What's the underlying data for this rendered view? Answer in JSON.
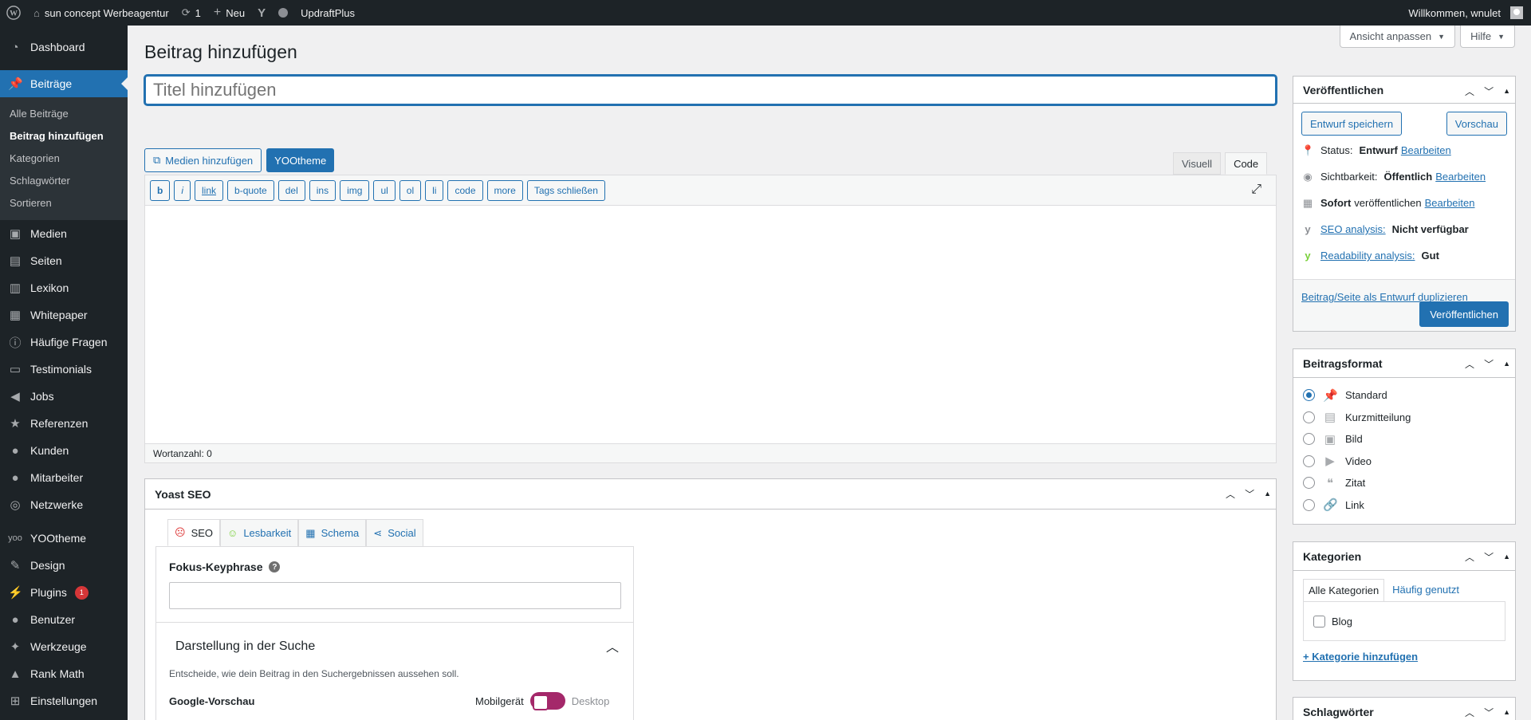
{
  "adminbar": {
    "site_name": "sun concept Werbeagentur",
    "updates_count": "1",
    "new_label": "Neu",
    "plugin_label": "UpdraftPlus",
    "welcome": "Willkommen, wnulet"
  },
  "sidebar": {
    "dashboard": "Dashboard",
    "posts": "Beiträge",
    "sub": [
      "Alle Beiträge",
      "Beitrag hinzufügen",
      "Kategorien",
      "Schlagwörter",
      "Sortieren"
    ],
    "items": [
      "Medien",
      "Seiten",
      "Lexikon",
      "Whitepaper",
      "Häufige Fragen",
      "Testimonials",
      "Jobs",
      "Referenzen",
      "Kunden",
      "Mitarbeiter",
      "Netzwerke",
      "YOOtheme",
      "Design",
      "Plugins",
      "Benutzer",
      "Werkzeuge",
      "Rank Math",
      "Einstellungen"
    ],
    "plugins_badge": "1"
  },
  "screen_options": {
    "customize": "Ansicht anpassen",
    "help": "Hilfe"
  },
  "page": {
    "title": "Beitrag hinzufügen",
    "title_placeholder": "Titel hinzufügen"
  },
  "editor": {
    "add_media": "Medien hinzufügen",
    "yootheme": "YOOtheme",
    "tab_visual": "Visuell",
    "tab_code": "Code",
    "quicktags": [
      "b",
      "i",
      "link",
      "b-quote",
      "del",
      "ins",
      "img",
      "ul",
      "ol",
      "li",
      "code",
      "more",
      "Tags schließen"
    ],
    "wordcount": "Wortanzahl: 0"
  },
  "publish": {
    "title": "Veröffentlichen",
    "save_draft": "Entwurf speichern",
    "preview": "Vorschau",
    "status_label": "Status:",
    "status_value": "Entwurf",
    "visibility_label": "Sichtbarkeit:",
    "visibility_value": "Öffentlich",
    "schedule_value": "Sofort",
    "schedule_label": "veröffentlichen",
    "edit": "Bearbeiten",
    "seo_label": "SEO analysis:",
    "seo_value": "Nicht verfügbar",
    "read_label": "Readability analysis:",
    "read_value": "Gut",
    "duplicate": "Beitrag/Seite als Entwurf duplizieren",
    "publish_button": "Veröffentlichen"
  },
  "format": {
    "title": "Beitragsformat",
    "options": [
      "Standard",
      "Kurzmitteilung",
      "Bild",
      "Video",
      "Zitat",
      "Link"
    ],
    "selected": "Standard"
  },
  "categories": {
    "title": "Kategorien",
    "tab_all": "Alle Kategorien",
    "tab_used": "Häufig genutzt",
    "items": [
      "Blog"
    ],
    "add": "+ Kategorie hinzufügen"
  },
  "tags_box": {
    "title": "Schlagwörter"
  },
  "yoast": {
    "title": "Yoast SEO",
    "tabs": [
      "SEO",
      "Lesbarkeit",
      "Schema",
      "Social"
    ],
    "focus_label": "Fokus-Keyphrase",
    "appearance_title": "Darstellung in der Suche",
    "appearance_desc": "Entscheide, wie dein Beitrag in den Suchergebnissen aussehen soll.",
    "google_preview": "Google-Vorschau",
    "mobile": "Mobilgerät",
    "desktop": "Desktop"
  },
  "colors": {
    "accent": "#2271b1",
    "adminbar": "#1d2327",
    "yoast_pink": "#a4286a"
  }
}
